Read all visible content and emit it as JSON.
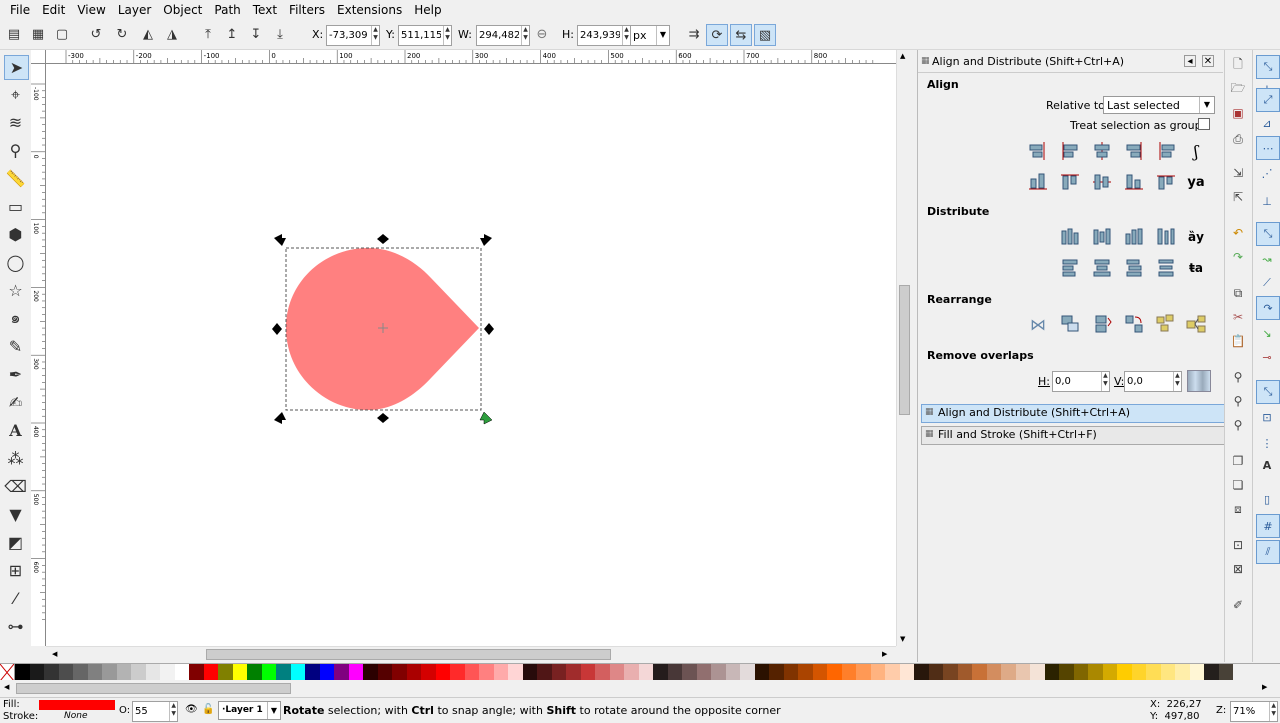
{
  "menu": [
    "File",
    "Edit",
    "View",
    "Layer",
    "Object",
    "Path",
    "Text",
    "Filters",
    "Extensions",
    "Help"
  ],
  "toolbar": {
    "x_label": "X:",
    "x_value": "-73,309",
    "y_label": "Y:",
    "y_value": "511,115",
    "w_label": "W:",
    "w_value": "294,482",
    "h_label": "H:",
    "h_value": "243,939",
    "unit": "px"
  },
  "ruler_top_labels": [
    "-300",
    "-200",
    "-100",
    "0",
    "100",
    "200",
    "300",
    "400",
    "500",
    "600",
    "700",
    "800"
  ],
  "ruler_left_labels": [
    "-100",
    "0",
    "100",
    "200",
    "300",
    "400",
    "500",
    "600"
  ],
  "shape": {
    "fill": "#ff8080"
  },
  "dock": {
    "panel_title": "Align and Distribute (Shift+Ctrl+A)",
    "align_title": "Align",
    "relative_label": "Relative to:",
    "relative_value": "Last selected",
    "treat_group_label": "Treat selection as group:",
    "distribute_title": "Distribute",
    "rearrange_title": "Rearrange",
    "remove_overlaps_title": "Remove overlaps",
    "h_label": "H:",
    "h_value": "0,0",
    "v_label": "V:",
    "v_value": "0,0",
    "tab_align": "Align and Distribute (Shift+Ctrl+A)",
    "tab_fill": "Fill and Stroke (Shift+Ctrl+F)"
  },
  "status": {
    "fill_label": "Fill:",
    "fill_color": "#ff0000",
    "stroke_label": "Stroke:",
    "stroke_value": "None",
    "opacity_label": "O:",
    "opacity_value": "55",
    "layer_name": "·Layer 1",
    "msg_1": "Rotate",
    "msg_2": " selection; with ",
    "msg_3": "Ctrl",
    "msg_4": " to snap angle; with ",
    "msg_5": "Shift",
    "msg_6": " to rotate around the opposite corner",
    "x_coord": "X:  226,27",
    "y_coord": "Y:  497,80",
    "zoom_label": "Z:",
    "zoom_value": "71%"
  },
  "palette_colors": [
    "#000000",
    "#1a1a1a",
    "#333333",
    "#4d4d4d",
    "#666666",
    "#808080",
    "#999999",
    "#b3b3b3",
    "#cccccc",
    "#e6e6e6",
    "#f2f2f2",
    "#ffffff",
    "#800000",
    "#ff0000",
    "#808000",
    "#ffff00",
    "#008000",
    "#00ff00",
    "#008080",
    "#00ffff",
    "#000080",
    "#0000ff",
    "#800080",
    "#ff00ff",
    "#2b0000",
    "#550000",
    "#800000",
    "#aa0000",
    "#d40000",
    "#ff0000",
    "#ff2a2a",
    "#ff5555",
    "#ff8080",
    "#ffaaaa",
    "#ffd5d5",
    "#280b0b",
    "#501616",
    "#782121",
    "#a02c2c",
    "#c83737",
    "#d35f5f",
    "#de8787",
    "#e9afaf",
    "#f4d7d7",
    "#241c1c",
    "#483737",
    "#6c5353",
    "#916f6f",
    "#ac9393",
    "#c8b7b7",
    "#e3dbdb",
    "#2b1100",
    "#552200",
    "#803300",
    "#aa4400",
    "#d45500",
    "#ff6600",
    "#ff7f2a",
    "#ff9955",
    "#ffb380",
    "#ffccaa",
    "#ffe6d5",
    "#28170b",
    "#502d16",
    "#784421",
    "#a05a2c",
    "#c87137",
    "#d38d5f",
    "#deaa87",
    "#e9c6af",
    "#f4e3d7",
    "#2b2200",
    "#554400",
    "#806600",
    "#aa8800",
    "#d4aa00",
    "#ffcc00",
    "#ffd42a",
    "#ffdd55",
    "#ffe680",
    "#ffeeaa",
    "#fff6d5",
    "#241f1c",
    "#484137"
  ]
}
